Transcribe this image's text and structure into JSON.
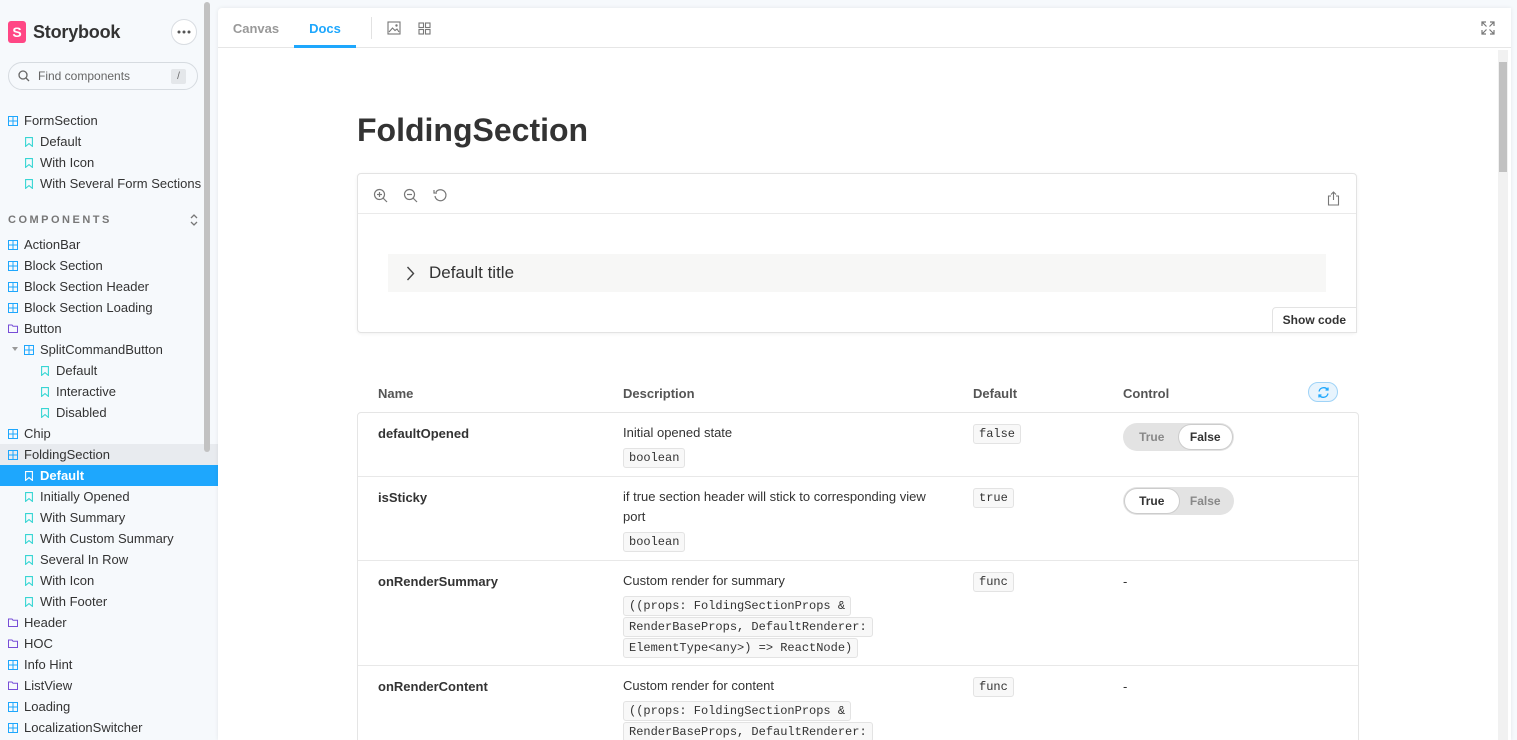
{
  "brand": {
    "name": "Storybook",
    "logo_letter": "S",
    "accent": "#ff4785"
  },
  "search": {
    "placeholder": "Find components",
    "shortcut": "/"
  },
  "sidebar": {
    "top_items": [
      {
        "label": "FormSection",
        "kind": "component"
      },
      {
        "label": "Default",
        "kind": "story"
      },
      {
        "label": "With Icon",
        "kind": "story"
      },
      {
        "label": "With Several Form Sections",
        "kind": "story"
      }
    ],
    "section_title": "COMPONENTS",
    "items": [
      {
        "label": "ActionBar",
        "kind": "component"
      },
      {
        "label": "Block Section",
        "kind": "component"
      },
      {
        "label": "Block Section Header",
        "kind": "component"
      },
      {
        "label": "Block Section Loading",
        "kind": "component"
      },
      {
        "label": "Button",
        "kind": "folder"
      },
      {
        "label": "SplitCommandButton",
        "kind": "component"
      },
      {
        "label": "Default",
        "kind": "story"
      },
      {
        "label": "Interactive",
        "kind": "story"
      },
      {
        "label": "Disabled",
        "kind": "story"
      },
      {
        "label": "Chip",
        "kind": "component"
      },
      {
        "label": "FoldingSection",
        "kind": "component"
      },
      {
        "label": "Default",
        "kind": "story"
      },
      {
        "label": "Initially Opened",
        "kind": "story"
      },
      {
        "label": "With Summary",
        "kind": "story"
      },
      {
        "label": "With Custom Summary",
        "kind": "story"
      },
      {
        "label": "Several In Row",
        "kind": "story"
      },
      {
        "label": "With Icon",
        "kind": "story"
      },
      {
        "label": "With Footer",
        "kind": "story"
      },
      {
        "label": "Header",
        "kind": "folder"
      },
      {
        "label": "HOC",
        "kind": "folder"
      },
      {
        "label": "Info Hint",
        "kind": "component"
      },
      {
        "label": "ListView",
        "kind": "folder"
      },
      {
        "label": "Loading",
        "kind": "component"
      },
      {
        "label": "LocalizationSwitcher",
        "kind": "component"
      }
    ],
    "selected_label": "Default"
  },
  "toolbar": {
    "tabs": [
      "Canvas",
      "Docs"
    ],
    "active_tab": "Docs"
  },
  "doc": {
    "title": "FoldingSection",
    "preview": {
      "folding_title": "Default title",
      "show_code": "Show code"
    },
    "args": {
      "headers": {
        "name": "Name",
        "description": "Description",
        "default": "Default",
        "control": "Control"
      },
      "rows": [
        {
          "name": "defaultOpened",
          "description": "Initial opened state",
          "type": "boolean",
          "default": "false",
          "control": {
            "true_label": "True",
            "false_label": "False",
            "value": false
          }
        },
        {
          "name": "isSticky",
          "description": "if true section header will stick to corresponding view port",
          "type": "boolean",
          "default": "true",
          "control": {
            "true_label": "True",
            "false_label": "False",
            "value": true
          }
        },
        {
          "name": "onRenderSummary",
          "description": "Custom render for summary",
          "type": "((props: FoldingSectionProps & RenderBaseProps, DefaultRenderer: ElementType<any>) => ReactNode)",
          "default": "func",
          "control_text": "-"
        },
        {
          "name": "onRenderContent",
          "description": "Custom render for content",
          "type": "((props: FoldingSectionProps & RenderBaseProps, DefaultRenderer:",
          "default": "func",
          "control_text": "-"
        }
      ]
    }
  },
  "colors": {
    "selection": "#1ea7fd",
    "component_icon": "#1ea7fd",
    "story_icon": "#37d5d3",
    "folder_icon": "#774dd7"
  }
}
